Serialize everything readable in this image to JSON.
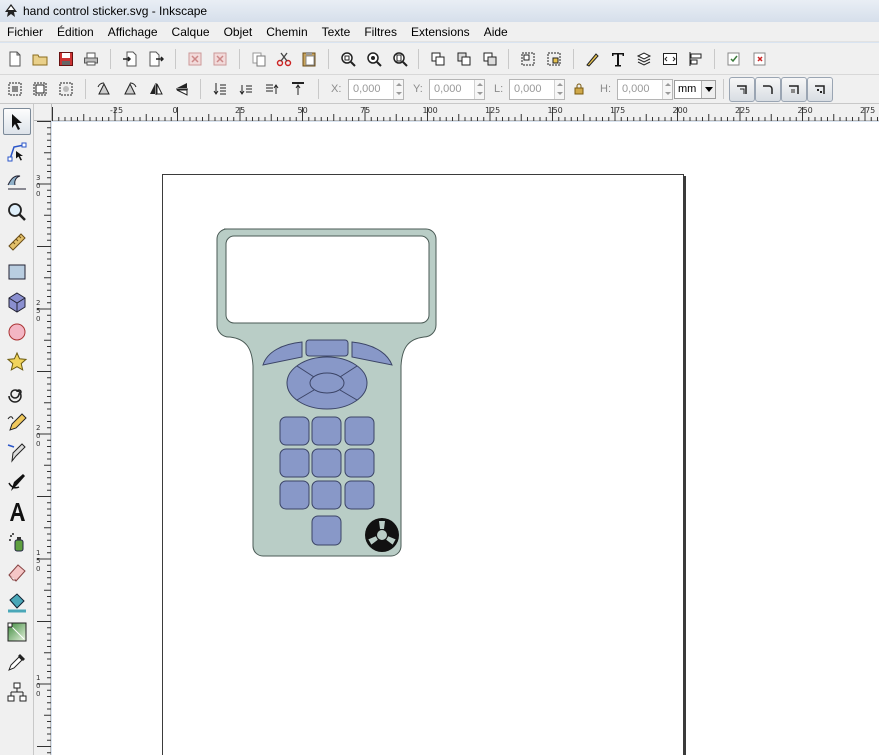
{
  "window": {
    "title": "hand control sticker.svg - Inkscape"
  },
  "menu": {
    "items": [
      {
        "label": "Fichier",
        "key": "fichier"
      },
      {
        "label": "Édition",
        "key": "edition"
      },
      {
        "label": "Affichage",
        "key": "affichage"
      },
      {
        "label": "Calque",
        "key": "calque"
      },
      {
        "label": "Objet",
        "key": "objet"
      },
      {
        "label": "Chemin",
        "key": "chemin"
      },
      {
        "label": "Texte",
        "key": "texte"
      },
      {
        "label": "Filtres",
        "key": "filtres"
      },
      {
        "label": "Extensions",
        "key": "extensions"
      },
      {
        "label": "Aide",
        "key": "aide"
      }
    ]
  },
  "selector_toolbar": {
    "x_label": "X:",
    "x_value": "0,000",
    "y_label": "Y:",
    "y_value": "0,000",
    "w_label": "L:",
    "w_value": "0,000",
    "h_label": "H:",
    "h_value": "0,000",
    "unit": "mm"
  },
  "ruler_top": {
    "labels": [
      "-25",
      "0",
      "25",
      "50",
      "75",
      "100",
      "125",
      "150",
      "175",
      "200",
      "225",
      "250",
      "275"
    ]
  },
  "ruler_left": {
    "labels": [
      "300",
      "250",
      "200",
      "150",
      "100"
    ]
  },
  "colors": {
    "device_body": "#b9cdc6",
    "device_outline": "#4a5a55",
    "button_fill": "#8898c8",
    "button_outline": "#3b4466",
    "screen_fill": "#ffffff",
    "logo": "#111111"
  },
  "tools": [
    {
      "name": "selector-tool-icon",
      "active": true
    },
    {
      "name": "node-tool-icon"
    },
    {
      "name": "tweak-tool-icon"
    },
    {
      "name": "zoom-tool-icon"
    },
    {
      "name": "measure-tool-icon"
    },
    {
      "name": "rectangle-tool-icon"
    },
    {
      "name": "3dbox-tool-icon"
    },
    {
      "name": "ellipse-tool-icon"
    },
    {
      "name": "star-tool-icon"
    },
    {
      "name": "spiral-tool-icon"
    },
    {
      "name": "pencil-tool-icon"
    },
    {
      "name": "pen-tool-icon"
    },
    {
      "name": "calligraphy-tool-icon"
    },
    {
      "name": "text-tool-icon"
    },
    {
      "name": "spray-tool-icon"
    },
    {
      "name": "eraser-tool-icon"
    },
    {
      "name": "paint-bucket-tool-icon"
    },
    {
      "name": "gradient-tool-icon"
    },
    {
      "name": "dropper-tool-icon"
    },
    {
      "name": "connector-tool-icon"
    }
  ]
}
